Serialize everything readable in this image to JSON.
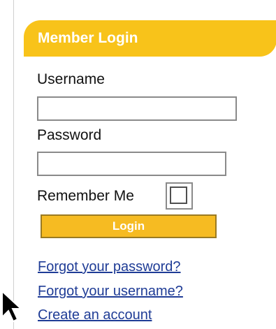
{
  "login_panel": {
    "title": "Member Login",
    "username_label": "Username",
    "username_value": "",
    "password_label": "Password",
    "password_value": "",
    "remember_label": "Remember Me",
    "remember_checked": false,
    "login_button_label": "Login"
  },
  "links": {
    "forgot_password": "Forgot your password?",
    "forgot_username": "Forgot your username?",
    "create_account": "Create an account"
  },
  "icons": {
    "pointer": "mouse-pointer-icon"
  },
  "colors": {
    "header_bg": "#f8c31a",
    "button_bg": "#f6bb22",
    "link": "#1f3c96",
    "text": "#111111"
  }
}
